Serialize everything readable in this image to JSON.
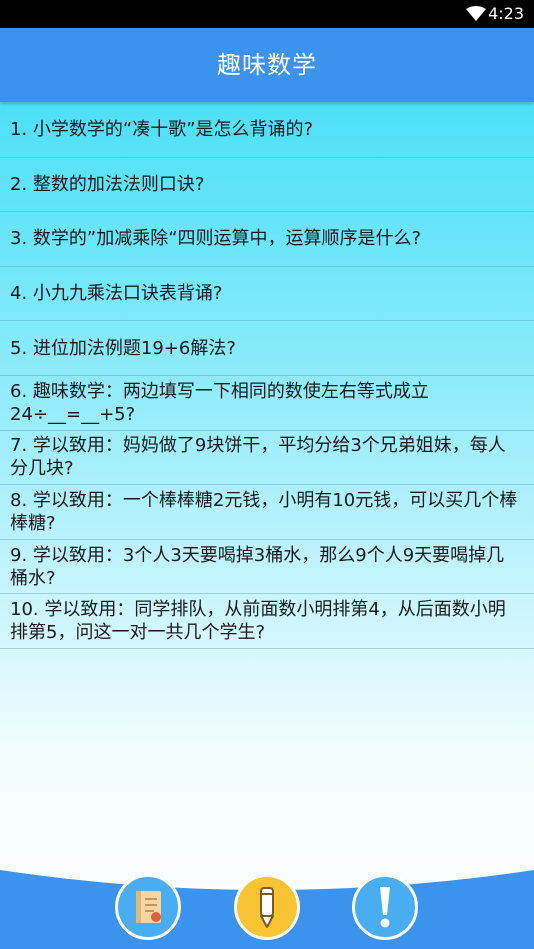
{
  "status_bar": {
    "time": "4:23",
    "icons": [
      "wifi-icon"
    ]
  },
  "header": {
    "title": "趣味数学"
  },
  "questions": [
    {
      "text": "1. 小学数学的“凑十歌”是怎么背诵的?"
    },
    {
      "text": "2. 整数的加法法则口诀?"
    },
    {
      "text": "3. 数学的”加减乘除“四则运算中，运算顺序是什么?"
    },
    {
      "text": "4. 小九九乘法口诀表背诵?"
    },
    {
      "text": "5. 进位加法例题19+6解法?"
    },
    {
      "text": "6. 趣味数学：两边填写一下相同的数使左右等式成立24÷__=__+5?"
    },
    {
      "text": "7. 学以致用：妈妈做了9块饼干，平均分给3个兄弟姐妹，每人分几块?"
    },
    {
      "text": "8. 学以致用：一个棒棒糖2元钱，小明有10元钱，可以买几个棒棒糖?"
    },
    {
      "text": "9. 学以致用：3个人3天要喝掉3桶水，那么9个人9天要喝掉几桶水?"
    },
    {
      "text": "10. 学以致用：同学排队，从前面数小明排第4，从后面数小明排第5，问这一对一共几个学生?"
    }
  ],
  "bottom_nav": {
    "buttons": [
      {
        "icon": "notebook-icon",
        "color": "#49adf2"
      },
      {
        "icon": "pencil-icon",
        "color": "#f8c431"
      },
      {
        "icon": "exclamation-icon",
        "color": "#49adf2"
      }
    ]
  },
  "colors": {
    "title_bar": "#3b93ee",
    "list_top": "#35dcf6",
    "bottom_wave": "#3b93ee"
  }
}
